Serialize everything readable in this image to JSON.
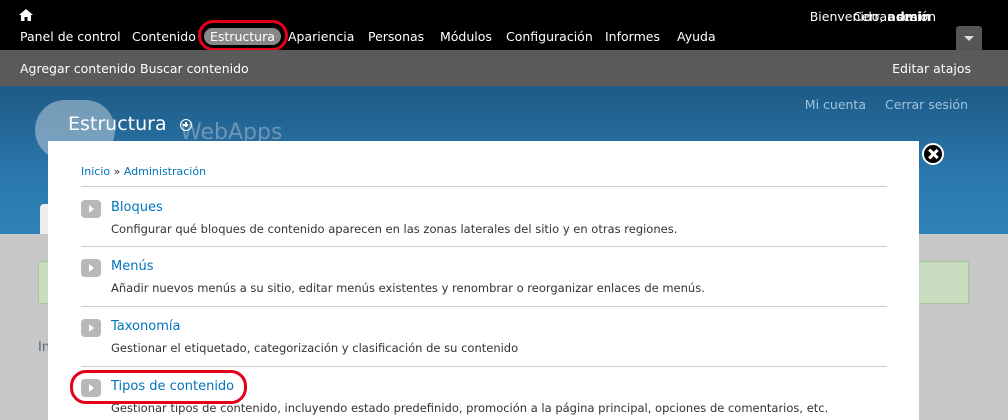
{
  "toolbar": {
    "menu": [
      {
        "label": "Panel de control",
        "active": false
      },
      {
        "label": "Contenido",
        "active": false
      },
      {
        "label": "Estructura",
        "active": true
      },
      {
        "label": "Apariencia",
        "active": false
      },
      {
        "label": "Personas",
        "active": false
      },
      {
        "label": "Módulos",
        "active": false
      },
      {
        "label": "Configuración",
        "active": false
      },
      {
        "label": "Informes",
        "active": false
      },
      {
        "label": "Ayuda",
        "active": false
      }
    ],
    "welcome": "Bienvenido,",
    "username": "admin",
    "logout": "Cerrar sesión"
  },
  "shortcuts": {
    "items": [
      "Agregar contenido",
      "Buscar contenido"
    ],
    "edit": "Editar atajos"
  },
  "site": {
    "links": [
      "Mi cuenta",
      "Cerrar sesión"
    ],
    "name": "WebApps",
    "ghost_text": "In"
  },
  "overlay": {
    "title": "Estructura",
    "breadcrumb": [
      "Inicio",
      "Administración"
    ],
    "breadcrumb_sep": "»",
    "items": [
      {
        "title": "Bloques",
        "description": "Configurar qué bloques de contenido aparecen en las zonas laterales del sitio y en otras regiones."
      },
      {
        "title": "Menús",
        "description": "Añadir nuevos menús a su sitio, editar menús existentes y renombrar o reorganizar enlaces de menús."
      },
      {
        "title": "Taxonomía",
        "description": "Gestionar el etiquetado, categorización y clasificación de su contenido"
      },
      {
        "title": "Tipos de contenido",
        "description": "Gestionar tipos de contenido, incluyendo estado predefinido, promoción a la página principal, opciones de comentarios, etc."
      }
    ]
  },
  "colors": {
    "link": "#0074bd",
    "highlight": "#e3001b",
    "toolbar_bg": "#000000",
    "shortcuts_bg": "#5a5a5a"
  },
  "icons": [
    "home-icon",
    "chevron-down-icon",
    "close-icon",
    "add-icon",
    "arrow-right-icon"
  ]
}
